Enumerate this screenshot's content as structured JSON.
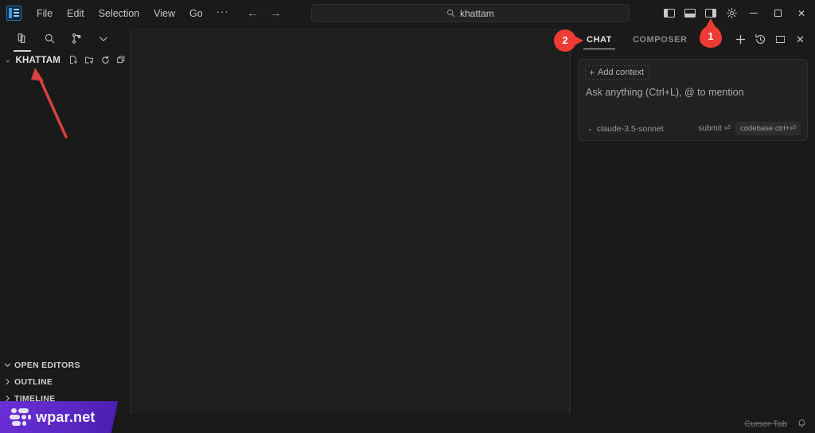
{
  "window": {
    "app_icon": "cursor-app-icon",
    "menu": [
      "File",
      "Edit",
      "Selection",
      "View",
      "Go",
      "···"
    ],
    "nav_back": "←",
    "nav_forward": "→",
    "search": {
      "value": "khattam",
      "icon": "search-icon"
    },
    "layout_toggles": [
      {
        "name": "toggle-primary-sidebar",
        "icon": "panel-left-icon"
      },
      {
        "name": "toggle-panel",
        "icon": "panel-bottom-icon"
      },
      {
        "name": "toggle-secondary-sidebar",
        "icon": "panel-right-icon"
      }
    ],
    "settings_icon": "gear-icon",
    "controls": [
      {
        "name": "minimize-button",
        "icon": "minimize-icon"
      },
      {
        "name": "maximize-button",
        "icon": "maximize-icon"
      },
      {
        "name": "close-button",
        "icon": "close-icon",
        "glyph": "✕"
      }
    ]
  },
  "sidebar": {
    "activity_icons": [
      {
        "name": "explorer-icon",
        "active": true
      },
      {
        "name": "search-icon",
        "active": false
      },
      {
        "name": "source-control-icon",
        "active": false
      },
      {
        "name": "more-views-chevron-icon",
        "active": false
      }
    ],
    "folder": {
      "name": "KHATTAM",
      "expanded_chevron": "⌄",
      "actions": [
        {
          "name": "new-file-icon"
        },
        {
          "name": "new-folder-icon"
        },
        {
          "name": "refresh-explorer-icon"
        },
        {
          "name": "collapse-folders-icon"
        }
      ]
    },
    "sections": [
      {
        "label": "OPEN EDITORS",
        "expanded": true
      },
      {
        "label": "OUTLINE",
        "expanded": false
      },
      {
        "label": "TIMELINE",
        "expanded": false
      }
    ]
  },
  "chat": {
    "tabs": [
      {
        "label": "CHAT",
        "active": true
      },
      {
        "label": "COMPOSER",
        "active": false
      }
    ],
    "header_icons": [
      {
        "name": "new-chat-icon",
        "glyph": "+"
      },
      {
        "name": "chat-history-icon"
      },
      {
        "name": "expand-chat-icon"
      },
      {
        "name": "close-chat-icon",
        "glyph": "✕"
      }
    ],
    "composer": {
      "add_context_label": "Add context",
      "add_context_plus": "+",
      "placeholder": "Ask anything (Ctrl+L), @ to mention",
      "model": "claude-3.5-sonnet",
      "model_chevron": "⌄",
      "submit_hint": "submit ⏎",
      "codebase_badge": "codebase ctrl+⏎"
    }
  },
  "statusbar": {
    "cursor_tab_label": "Cursor Tab",
    "bell_icon": "bell-icon"
  },
  "annotations": {
    "pins": [
      {
        "number": "1",
        "direction": "up"
      },
      {
        "number": "2",
        "direction": "right"
      }
    ],
    "arrow": {
      "name": "pointer-arrow",
      "color": "#d94140"
    }
  },
  "watermark": {
    "text": "wpar.net",
    "color": "#6b2fd6"
  }
}
